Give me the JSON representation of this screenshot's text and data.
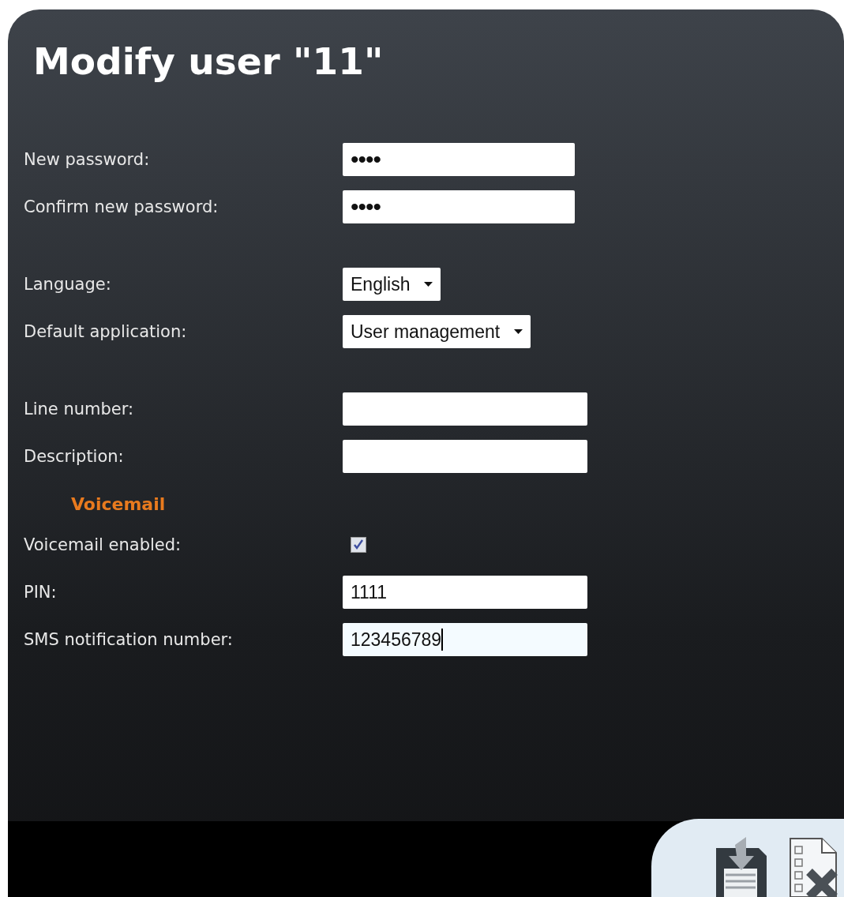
{
  "title": "Modify user \"11\"",
  "groups": [
    {
      "rows": [
        {
          "kind": "password",
          "label": "New password:",
          "value": "••••"
        },
        {
          "kind": "password",
          "label": "Confirm new password:",
          "value": "••••"
        }
      ]
    },
    {
      "rows": [
        {
          "kind": "select",
          "label": "Language:",
          "value": "English"
        },
        {
          "kind": "select",
          "label": "Default application:",
          "value": "User management"
        }
      ]
    },
    {
      "rows": [
        {
          "kind": "text",
          "label": "Line number:"
        },
        {
          "kind": "text",
          "label": "Description:"
        }
      ]
    },
    {
      "heading": "Voicemail",
      "rows": [
        {
          "kind": "checkbox",
          "label": "Voicemail enabled:",
          "checked": true
        },
        {
          "kind": "text",
          "label": "PIN:",
          "value": "1111"
        },
        {
          "kind": "text",
          "label": "SMS notification number:",
          "value": "123456789",
          "focused": true
        }
      ]
    }
  ]
}
